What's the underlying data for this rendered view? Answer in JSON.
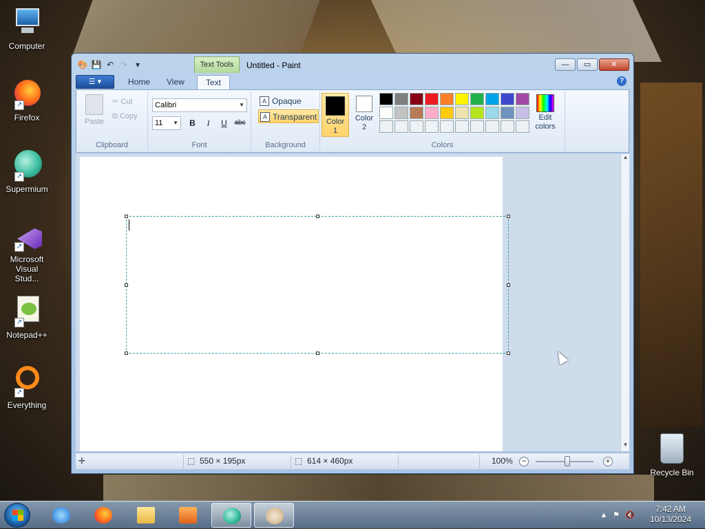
{
  "desktop": {
    "icons": [
      {
        "label": "Computer",
        "icon": "computer-icon"
      },
      {
        "label": "Firefox",
        "icon": "firefox-icon"
      },
      {
        "label": "Supermium",
        "icon": "supermium-icon"
      },
      {
        "label": "Microsoft Visual Stud...",
        "icon": "visual-studio-icon"
      },
      {
        "label": "Notepad++",
        "icon": "notepadpp-icon"
      },
      {
        "label": "Everything",
        "icon": "everything-icon"
      }
    ],
    "recycle_bin": "Recycle Bin"
  },
  "window": {
    "title": "Untitled - Paint",
    "contextual_tab": "Text Tools",
    "tabs": [
      "Home",
      "View",
      "Text"
    ],
    "active_tab": "Text",
    "buttons": {
      "minimize": "—",
      "maximize": "▭",
      "close": "✕"
    }
  },
  "ribbon": {
    "clipboard": {
      "label": "Clipboard",
      "paste": "Paste",
      "cut": "Cut",
      "copy": "Copy"
    },
    "font": {
      "label": "Font",
      "family": "Calibri",
      "size": "11",
      "bold": "B",
      "italic": "I",
      "underline": "U",
      "strike": "abc"
    },
    "background": {
      "label": "Background",
      "opaque": "Opaque",
      "transparent": "Transparent",
      "selected": "Transparent"
    },
    "colors": {
      "label": "Colors",
      "color1": {
        "label": "Color 1",
        "value": "#000000"
      },
      "color2": {
        "label": "Color 2",
        "value": "#ffffff"
      },
      "edit": "Edit colors",
      "palette": [
        "#000000",
        "#7f7f7f",
        "#880015",
        "#ed1c24",
        "#ff7f27",
        "#fff200",
        "#22b14c",
        "#00a2e8",
        "#3f48cc",
        "#a349a4",
        "#ffffff",
        "#c3c3c3",
        "#b97a57",
        "#ffaec9",
        "#ffc90e",
        "#efe4b0",
        "#b5e61d",
        "#99d9ea",
        "#7092be",
        "#c8bfe7",
        "#eef1f5",
        "#eef1f5",
        "#eef1f5",
        "#eef1f5",
        "#eef1f5",
        "#eef1f5",
        "#eef1f5",
        "#eef1f5",
        "#eef1f5",
        "#eef1f5"
      ]
    }
  },
  "status": {
    "selection_size": "550 × 195px",
    "canvas_size": "614 × 460px",
    "zoom": "100%",
    "zoom_level": 1.0
  },
  "taskbar": {
    "time": "7:42 AM",
    "date": "10/13/2024"
  }
}
